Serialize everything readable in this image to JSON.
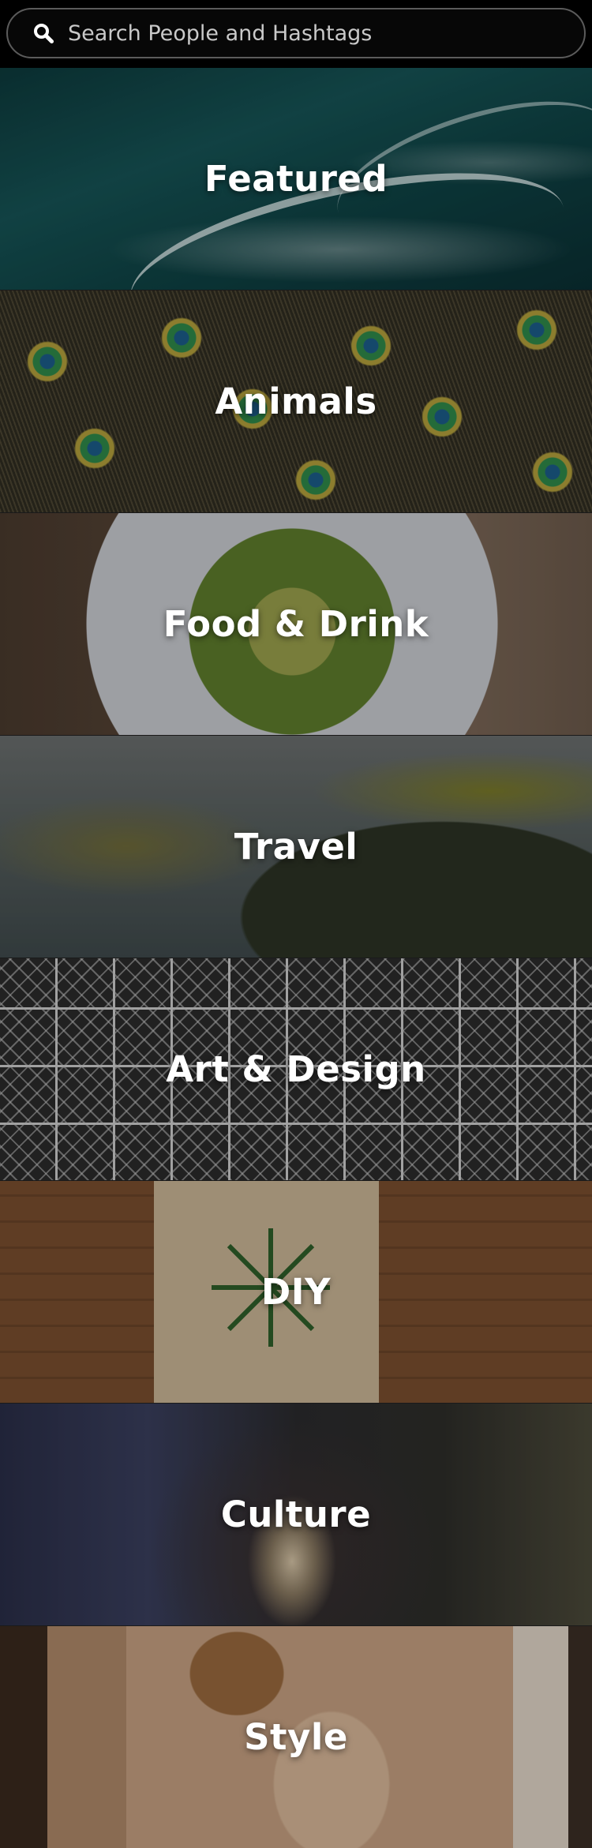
{
  "search": {
    "placeholder": "Search People and Hashtags"
  },
  "icons": {
    "search": "search-icon"
  },
  "categories": [
    {
      "label": "Featured"
    },
    {
      "label": "Animals"
    },
    {
      "label": "Food & Drink"
    },
    {
      "label": "Travel"
    },
    {
      "label": "Art & Design"
    },
    {
      "label": "DIY"
    },
    {
      "label": "Culture"
    },
    {
      "label": "Style"
    }
  ]
}
